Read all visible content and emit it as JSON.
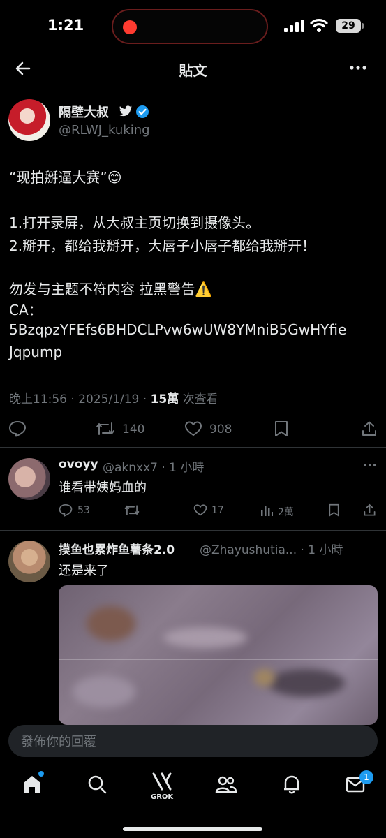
{
  "status": {
    "time": "1:21",
    "battery": "29"
  },
  "nav": {
    "title": "貼文"
  },
  "post": {
    "author_name": "隔壁大叔",
    "handle": "@RLWJ_kuking",
    "lines": [
      "“现拍掰逼大赛”😊",
      "1.打开录屏，从大叔主页切换到摄像头。",
      "2.掰开，都给我掰开，大唇子小唇子都给我掰开！",
      "勿发与主题不符内容 拉黑警告⚠️",
      "CA：",
      "5BzqpzYFEfs6BHDCLPvw6wUW8YMniB5GwHYfie",
      "Jqpump"
    ],
    "meta_time": "晚上11:56 · 2025/1/19 · ",
    "views_count": "15萬",
    "views_label": " 次查看",
    "retweets": "140",
    "likes": "908"
  },
  "replies": [
    {
      "name": "ovoyy",
      "handle": "@aknxx7 · 1 小時",
      "text": "谁看带姨妈血的",
      "comments": "53",
      "likes": "17",
      "views": "2萬"
    },
    {
      "name": "摸鱼也累炸鱼薯条2.0",
      "handle": "@Zhayushutia... · 1 小時",
      "text": "还是来了"
    }
  ],
  "composer": {
    "placeholder": "發佈你的回覆"
  },
  "tabbar": {
    "grok_label": "GROK",
    "messages_badge": "1"
  },
  "colors": {
    "accent": "#1d9bf0",
    "background": "#000000",
    "muted": "#71767b"
  }
}
